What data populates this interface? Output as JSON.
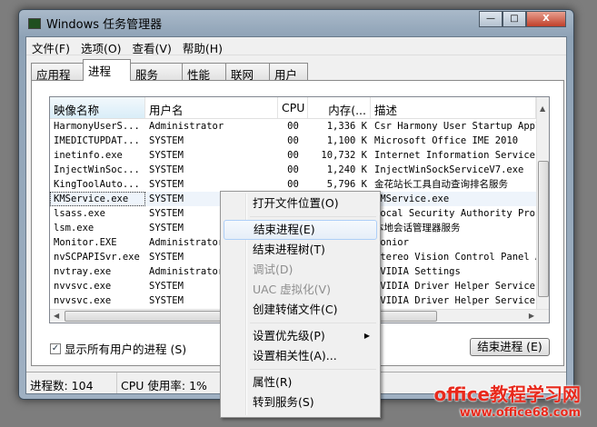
{
  "title": "Windows 任务管理器",
  "window_controls": {
    "minimize": "—",
    "maximize": "□",
    "close": "X"
  },
  "menu": [
    "文件(F)",
    "选项(O)",
    "查看(V)",
    "帮助(H)"
  ],
  "tabs": [
    "应用程序",
    "进程",
    "服务",
    "性能",
    "联网",
    "用户"
  ],
  "columns": [
    "映像名称",
    "用户名",
    "CPU",
    "内存(...",
    "描述"
  ],
  "rows": [
    [
      "HarmonyUserS...",
      "Administrator",
      "00",
      "1,336 K",
      "Csr Harmony User Startup Appl"
    ],
    [
      "IMEDICTUPDAT...",
      "SYSTEM",
      "00",
      "1,100 K",
      "Microsoft Office IME 2010"
    ],
    [
      "inetinfo.exe",
      "SYSTEM",
      "00",
      "10,732 K",
      "Internet Information Services"
    ],
    [
      "InjectWinSoc...",
      "SYSTEM",
      "00",
      "1,240 K",
      "InjectWinSockServiceV7.exe"
    ],
    [
      "KingToolAuto...",
      "SYSTEM",
      "00",
      "5,796 K",
      "金花站长工具自动查询排名服务"
    ],
    [
      "KMService.exe",
      "SYSTEM",
      "",
      "",
      "KMService.exe"
    ],
    [
      "lsass.exe",
      "SYSTEM",
      "",
      "",
      "Local Security Authority Proc"
    ],
    [
      "lsm.exe",
      "SYSTEM",
      "",
      "",
      "本地会话管理器服务"
    ],
    [
      "Monitor.EXE",
      "Administrator",
      "",
      "",
      "Monior"
    ],
    [
      "nvSCPAPISvr.exe",
      "SYSTEM",
      "",
      "",
      "Stereo Vision Control Panel A"
    ],
    [
      "nvtray.exe",
      "Administrator",
      "",
      "",
      "NVIDIA Settings"
    ],
    [
      "nvvsvc.exe",
      "SYSTEM",
      "",
      "",
      "NVIDIA Driver Helper Service,"
    ],
    [
      "nvvsvc.exe",
      "SYSTEM",
      "",
      "",
      "NVIDIA Driver Helper Service,"
    ]
  ],
  "show_all_label": "显示所有用户的进程 (S)",
  "show_all_checked": true,
  "end_process_button": "结束进程 (E)",
  "status": {
    "processes": "进程数: 104",
    "cpu": "CPU 使用率: 1%"
  },
  "context_menu": {
    "open_location": "打开文件位置(O)",
    "end_process": "结束进程(E)",
    "end_tree": "结束进程树(T)",
    "debug": "调试(D)",
    "uac": "UAC 虚拟化(V)",
    "dump": "创建转储文件(C)",
    "priority": "设置优先级(P)",
    "affinity": "设置相关性(A)...",
    "properties": "属性(R)",
    "goto_service": "转到服务(S)"
  },
  "watermark": {
    "line1": "office教程学习网",
    "line2": "www.office68.com"
  }
}
